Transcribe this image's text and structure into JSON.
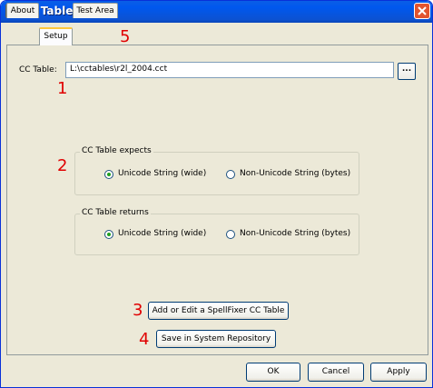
{
  "window": {
    "title": "CC Table"
  },
  "tabs": [
    {
      "label": "About",
      "active": false
    },
    {
      "label": "Setup",
      "active": true
    },
    {
      "label": "Test Area",
      "active": false
    }
  ],
  "setup": {
    "cc_table_label": "CC Table:",
    "cc_table_value": "L:\\cctables\\r2l_2004.cct",
    "browse_label": "...",
    "expects": {
      "title": "CC Table expects",
      "options": [
        "Unicode String (wide)",
        "Non-Unicode String (bytes)"
      ],
      "selected": "Unicode String (wide)"
    },
    "returns": {
      "title": "CC Table returns",
      "options": [
        "Unicode String (wide)",
        "Non-Unicode String (bytes)"
      ],
      "selected": "Unicode String (wide)"
    },
    "add_edit_button": "Add or Edit a SpellFixer CC Table",
    "save_button": "Save in System Repository"
  },
  "annotations": {
    "n1": "1",
    "n2": "2",
    "n3": "3",
    "n4": "4",
    "n5": "5",
    "color": "#e00000"
  },
  "footer": {
    "ok": "OK",
    "cancel": "Cancel",
    "apply": "Apply"
  },
  "colors": {
    "titlebar": "#0058ee",
    "close_button": "#e2542e",
    "dialog_bg": "#ece9d8",
    "active_tab_accent": "#ffc83c"
  }
}
